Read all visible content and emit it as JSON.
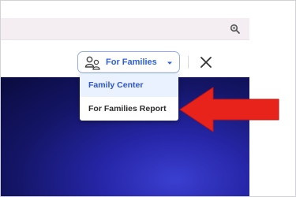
{
  "toolbar": {
    "role_label": "For Families",
    "role_icon": "people-icon",
    "caret_icon": "caret-down-icon",
    "close_icon": "close-icon",
    "zoom_icon": "zoom-icon"
  },
  "menu": {
    "items": [
      {
        "label": "Family Center",
        "active": true
      },
      {
        "label": "For Families Report",
        "active": false
      }
    ]
  },
  "annotation": {
    "arrow_color": "#e8231b",
    "direction": "left"
  },
  "colors": {
    "accent": "#2f5fd8",
    "hero_dark": "#0a0b3e",
    "hero_light": "#3b3fd0",
    "top_bar": "#f4eef2"
  }
}
